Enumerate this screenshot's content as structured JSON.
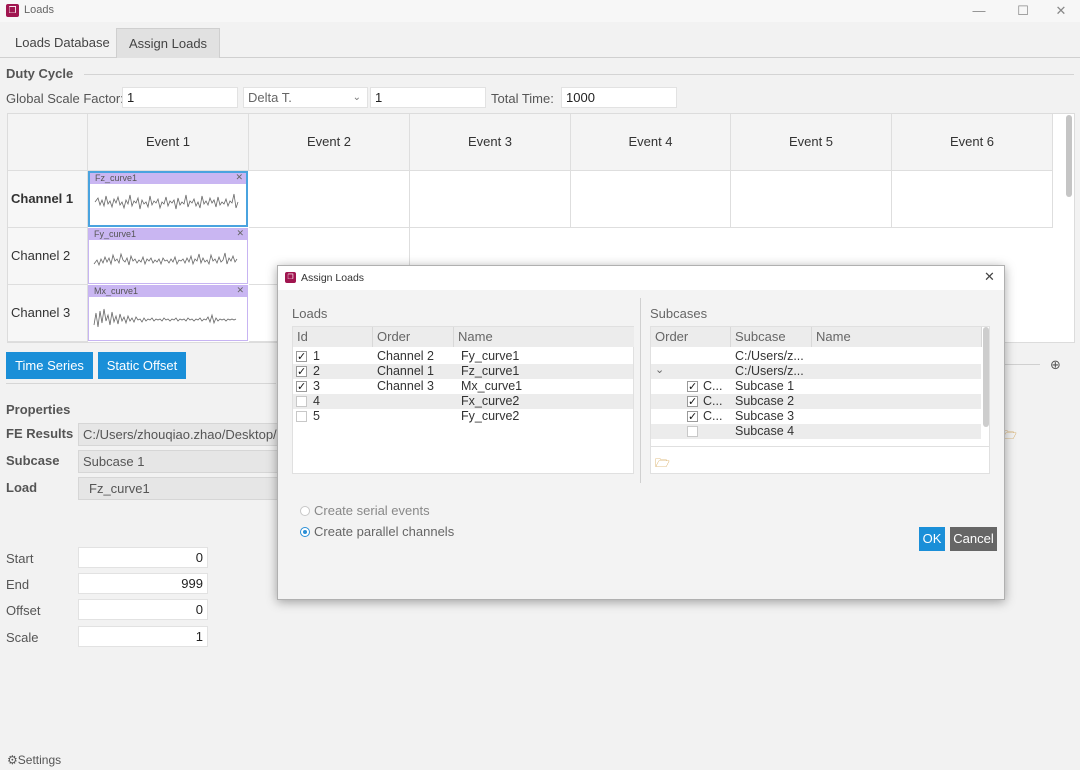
{
  "window": {
    "title": "Loads",
    "minimize": "—",
    "maximize": "☐",
    "close": "✕"
  },
  "tabs": [
    {
      "label": "Loads Database"
    },
    {
      "label": "Assign Loads"
    }
  ],
  "duty_cycle": {
    "title": "Duty Cycle",
    "global_scale_label": "Global Scale Factor:",
    "global_scale_value": "1",
    "delta_select": "Delta T.",
    "delta_value": "1",
    "total_time_label": "Total Time:",
    "total_time_value": "1000"
  },
  "grid": {
    "events": [
      "Event 1",
      "Event 2",
      "Event 3",
      "Event 4",
      "Event 5",
      "Event 6"
    ],
    "channels": [
      "Channel 1",
      "Channel 2",
      "Channel 3"
    ],
    "curves": [
      "Fz_curve1",
      "Fy_curve1",
      "Mx_curve1"
    ]
  },
  "buttons": {
    "time_series": "Time Series",
    "static_offset": "Static Offset"
  },
  "properties": {
    "title": "Properties",
    "fe_results_label": "FE Results",
    "fe_results_value": "C:/Users/zhouqiao.zhao/Desktop/",
    "subcase_label": "Subcase",
    "subcase_value": "Subcase 1",
    "load_label": "Load",
    "load_value": "Fz_curve1",
    "start_label": "Start",
    "start_value": "0",
    "end_label": "End",
    "end_value": "999",
    "offset_label": "Offset",
    "offset_value": "0",
    "scale_label": "Scale",
    "scale_value": "1"
  },
  "settings_label": "Settings",
  "dialog": {
    "title": "Assign Loads",
    "loads_title": "Loads",
    "loads_columns": [
      "Id",
      "Order",
      "Name"
    ],
    "loads_rows": [
      {
        "id": "1",
        "order": "Channel 2",
        "name": "Fy_curve1",
        "checked": true
      },
      {
        "id": "2",
        "order": "Channel 1",
        "name": "Fz_curve1",
        "checked": true
      },
      {
        "id": "3",
        "order": "Channel 3",
        "name": "Mx_curve1",
        "checked": true
      },
      {
        "id": "4",
        "order": "",
        "name": "Fx_curve2",
        "checked": false
      },
      {
        "id": "5",
        "order": "",
        "name": "Fy_curve2",
        "checked": false
      }
    ],
    "subcases_title": "Subcases",
    "subcases_columns": [
      "Order",
      "Subcase",
      "Name"
    ],
    "subcases_rows": [
      {
        "order": "",
        "subcase": "C:/Users/z...",
        "checked": null
      },
      {
        "order": "",
        "subcase": "C:/Users/z...",
        "checked": null
      },
      {
        "order": "C...",
        "subcase": "Subcase 1",
        "checked": true
      },
      {
        "order": "C...",
        "subcase": "Subcase 2",
        "checked": true
      },
      {
        "order": "C...",
        "subcase": "Subcase 3",
        "checked": true
      },
      {
        "order": "",
        "subcase": "Subcase 4",
        "checked": false
      }
    ],
    "serial_option": "Create serial events",
    "parallel_option": "Create parallel channels",
    "ok": "OK",
    "cancel": "Cancel"
  },
  "colors": {
    "accent": "#1a8fd8",
    "curve_header": "#c9b6f2",
    "brand": "#a0154f"
  }
}
